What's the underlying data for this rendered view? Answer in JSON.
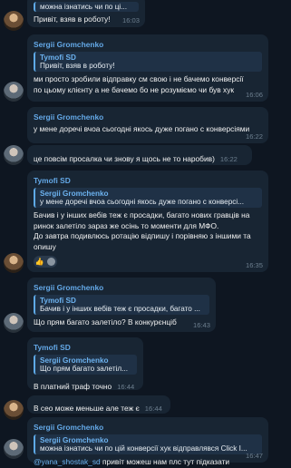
{
  "messages": [
    {
      "id": "m1",
      "reply": null,
      "top_text": "можна ізнатись чи по ці...",
      "text": "Привіт, взяв в роботу!",
      "time": "16:03"
    },
    {
      "id": "m2",
      "sender": "Sergii Gromchenko",
      "reply": {
        "name": "Tymofi SD",
        "text": "Привіт, взяв в роботу!"
      },
      "text": "ми просто зробили відправку см свою і не бачемо конверсії по цьому клієнту а не бачемо бо не розуміємо чи був хук",
      "time": "16:06"
    },
    {
      "id": "m3",
      "sender": "Sergii Gromchenko",
      "text": "у мене доречі вчоа сьогодні якось дуже погано с конверсіями",
      "time": "16:22"
    },
    {
      "id": "m4",
      "text": "це повсім просалка чи знову я щось не то наробив)",
      "time": "16:22"
    },
    {
      "id": "m5",
      "sender": "Tymofi SD",
      "reply": {
        "name": "Sergii Gromchenko",
        "text": "у мене доречі вчоа сьогодні якось дуже погано с конверсі..."
      },
      "text": "Бачив і у інших вебів теж є просадки, багато нових гравців на ринок залетіло зараз же осінь то моменти для МФО.\nДо завтра подивлюсь ротацію відпишу і порівняю з іншими та опишу",
      "time": "16:35",
      "reaction": "👍"
    },
    {
      "id": "m6",
      "sender": "Sergii Gromchenko",
      "reply": {
        "name": "Tymofi SD",
        "text": "Бачив і у інших вебів теж є просадки, багато ..."
      },
      "text": "Що прям багато залетіло? В конкурєнціб",
      "time": "16:43"
    },
    {
      "id": "m7",
      "sender": "Tymofi SD",
      "reply": {
        "name": "Sergii Gromchenko",
        "text": "Що прям багато залетіл..."
      },
      "text": "В платний траф точно",
      "time": "16:44"
    },
    {
      "id": "m8",
      "text": "В сео може меньше але теж є",
      "time": "16:44"
    },
    {
      "id": "m9",
      "sender": "Sergii Gromchenko",
      "reply": {
        "name": "Sergii Gromchenko",
        "text": "можна ізнатись чи по цій конверсії хук відправлявся Click I..."
      },
      "mention": "@yana_shostak_sd",
      "text": " привіт можеш нам плс тут підказати",
      "time": "16:47"
    }
  ]
}
